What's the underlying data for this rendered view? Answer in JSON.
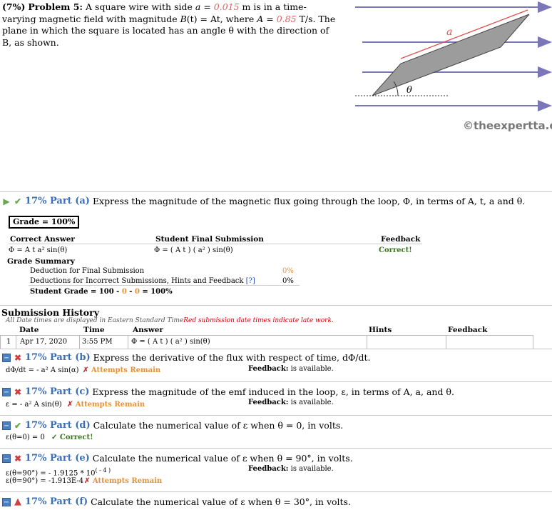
{
  "problem": {
    "pct": "(7%)",
    "label": "Problem 5:",
    "t1": "A square wire with side",
    "a_sym": "a",
    "eq1": " = ",
    "a_val": "0.015",
    "t2": " m is in a time-varying magnetic field with magnitude ",
    "B_expr": "B",
    "t3": "(t) = At, where ",
    "A_sym": "A",
    "eq2": " = ",
    "A_val": "0.85",
    "t4": " T/s. The plane in which the square is located has an angle θ with the direction of B, as shown."
  },
  "figure": {
    "side_label": "a",
    "angle_label": "θ",
    "watermark": "©theexpertta.com"
  },
  "part_a": {
    "pct": "17% Part (a)",
    "prompt": "Express the magnitude of the magnetic flux going through the loop, Φ, in terms of A, t, a and θ.",
    "grade": "Grade = 100%",
    "col_correct": "Correct Answer",
    "col_student": "Student Final Submission",
    "col_feedback": "Feedback",
    "correct_answer": "Φ = A t a² sin(θ)",
    "student_answer": "Φ = ( A t ) ( a² ) sin(θ)",
    "feedback": "Correct!",
    "grade_summary": "Grade Summary",
    "ded_final": "Deduction for Final Submission",
    "ded_final_val": "0%",
    "ded_incorrect": "Deductions for Incorrect Submissions, Hints and Feedback",
    "ded_incorrect_link": "[?]",
    "ded_incorrect_val": "0%",
    "student_grade_prefix": "Student Grade = 100 - ",
    "sg_0a": "0",
    "sg_mid": " - ",
    "sg_0b": "0",
    "sg_end": " = 100%"
  },
  "history": {
    "title": "Submission History",
    "note": "All Date times are displayed in Eastern Standard Time",
    "note_red": "Red submission date times indicate late work.",
    "headers": [
      "Date",
      "Time",
      "Answer",
      "Hints",
      "Feedback"
    ],
    "rows": [
      {
        "num": "1",
        "date": "Apr 17, 2020",
        "time": "3:55 PM",
        "answer": "Φ = ( A t ) ( a² ) sin(θ)",
        "hints": "",
        "feedback": ""
      }
    ]
  },
  "part_b": {
    "pct": "17% Part (b)",
    "prompt": "Express the derivative of the flux with respect of time, dΦ/dt.",
    "answer": "dΦ/dt = - a² A sin(α)",
    "status": "Attempts Remain",
    "fb_label": "Feedback:",
    "fb_text": "is available."
  },
  "part_c": {
    "pct": "17% Part (c)",
    "prompt": "Express the magnitude of the emf induced in the loop, ε, in terms of A, a, and θ.",
    "answer": "ε = - a² A sin(θ)",
    "status": "Attempts Remain",
    "fb_label": "Feedback:",
    "fb_text": "is available."
  },
  "part_d": {
    "pct": "17% Part (d)",
    "prompt": "Calculate the numerical value of ε when θ = 0, in volts.",
    "answer": "ε(θ=0) = 0",
    "status": "Correct!"
  },
  "part_e": {
    "pct": "17% Part (e)",
    "prompt": "Calculate the numerical value of ε when θ = 90°, in volts.",
    "answer1": "ε(θ=90°) = - 1.9125 * 10",
    "answer1_exp": "( - 4 )",
    "answer2": "ε(θ=90°) = -1.913E-4",
    "status": "Attempts Remain",
    "fb_label": "Feedback:",
    "fb_text": "is available."
  },
  "part_f": {
    "pct": "17% Part (f)",
    "prompt": "Calculate the numerical value of ε when θ = 30°, in volts."
  },
  "colors": {
    "accent_blue": "#3a6fb5",
    "figure_arrow": "#7a76b8",
    "correct_green": "#38761d",
    "attempts_orange": "#e69138"
  }
}
